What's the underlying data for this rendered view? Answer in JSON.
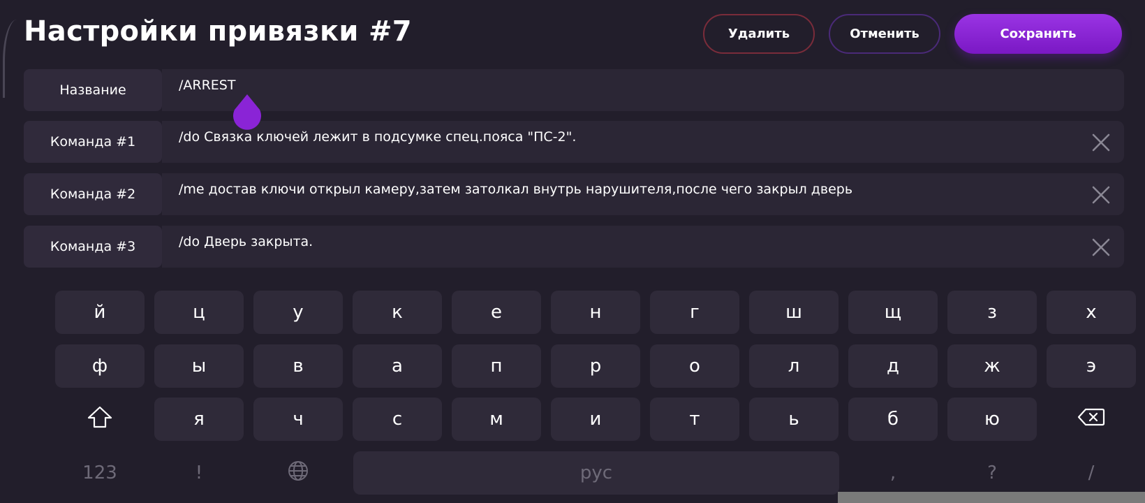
{
  "header": {
    "title": "Настройки привязки #7",
    "delete_label": "Удалить",
    "cancel_label": "Отменить",
    "save_label": "Сохранить"
  },
  "rows": [
    {
      "label": "Название",
      "value": "/ARREST"
    },
    {
      "label": "Команда #1",
      "value": "/do Связка ключей лежит в подсумке спец.пояса \"ПС-2\"."
    },
    {
      "label": "Команда #2",
      "value": "/me достав ключи открыл камеру,затем затолкал внутрь нарушителя,после чего закрыл дверь"
    },
    {
      "label": "Команда #3",
      "value": "/do Дверь закрыта."
    }
  ],
  "keyboard": {
    "row1": [
      "й",
      "ц",
      "у",
      "к",
      "е",
      "н",
      "г",
      "ш",
      "щ",
      "з",
      "х"
    ],
    "row2": [
      "ф",
      "ы",
      "в",
      "а",
      "п",
      "р",
      "о",
      "л",
      "д",
      "ж",
      "э"
    ],
    "row3": [
      "я",
      "ч",
      "с",
      "м",
      "и",
      "т",
      "ь",
      "б",
      "ю"
    ],
    "numbers_label": "123",
    "exclamation_label": "!",
    "space_label": "рус",
    "comma_label": ",",
    "question_label": "?",
    "slash_label": "/"
  },
  "colors": {
    "background": "#221e2b",
    "accent": "#8a24d6",
    "delete_border": "#7a2c3a",
    "cancel_border": "#4a2a78",
    "key_bg": "#2f2a39"
  }
}
